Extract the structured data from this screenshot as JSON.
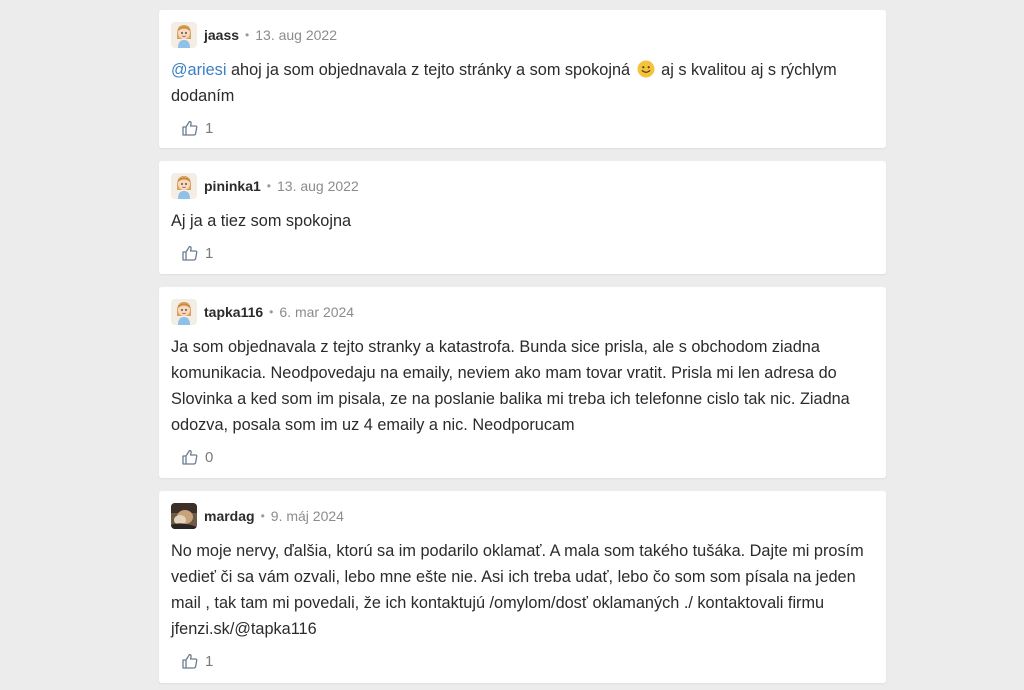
{
  "comments": [
    {
      "username": "jaass",
      "date": "13. aug 2022",
      "mention": "@ariesi",
      "text_before": " ahoj ja som objednavala z tejto stránky a som spokojná",
      "emoji": "slightly-smiling-face",
      "text_after": " aj s kvalitou aj s rýchlym dodaním",
      "likes": "1",
      "avatar": "girl-avatar-icon"
    },
    {
      "username": "pininka1",
      "date": "13. aug 2022",
      "text": "Aj ja a tiez som spokojna",
      "likes": "1",
      "avatar": "girl-avatar-icon"
    },
    {
      "username": "tapka116",
      "date": "6. mar 2024",
      "text": "Ja som objednavala z tejto stranky a katastrofa. Bunda sice prisla, ale s obchodom ziadna komunikacia. Neodpovedaju na emaily, neviem ako mam tovar vratit. Prisla mi len adresa do Slovinka a ked som im pisala, ze na poslanie balika mi treba ich telefonne cislo tak nic. Ziadna odozva, posala som im uz 4 emaily a nic. Neodporucam",
      "likes": "0",
      "avatar": "girl-avatar-icon"
    },
    {
      "username": "mardag",
      "date": "9. máj 2024",
      "text": "No moje nervy, ďalšia, ktorú sa im podarilo oklamať. A mala som takého tušáka. Dajte mi prosím vedieť či sa vám ozvali, lebo mne ešte nie. Asi ich treba udať, lebo čo som som písala na jeden mail , tak tam mi povedali, že ich kontaktujú /omylom/dosť oklamaných ./ kontaktovali firmu jfenzi.sk/@tapka116",
      "likes": "1",
      "avatar": "photo-avatar"
    }
  ],
  "separator": "•",
  "colors": {
    "background": "#ececec",
    "card": "#ffffff",
    "mention": "#3b7fc4",
    "meta": "#8c8c8c"
  }
}
